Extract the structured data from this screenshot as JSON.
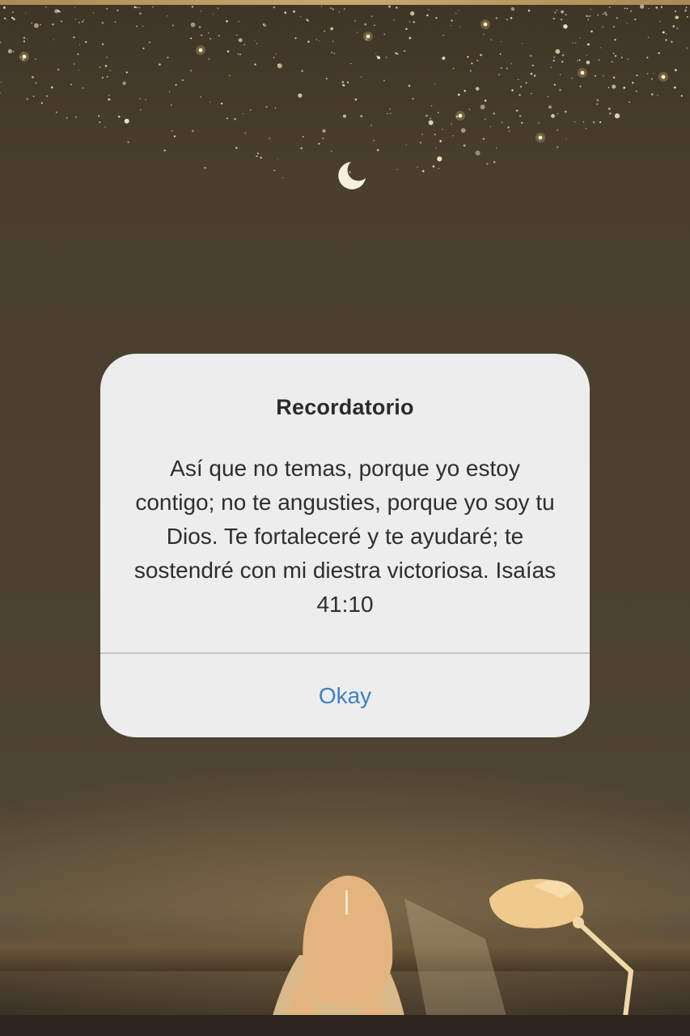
{
  "alert": {
    "title": "Recordatorio",
    "message": "Así que no temas, porque yo estoy contigo; no te angusties, porque yo soy tu Dios. Te fortaleceré y te ayudaré; te sostendré con mi diestra victoriosa. Isaías 41:10",
    "button_label": "Okay"
  },
  "colors": {
    "dialog_background": "#ededee",
    "button_text": "#3d82c4",
    "wallpaper_base": "#4a3f2e"
  },
  "wallpaper": {
    "icons": [
      "moon-icon",
      "stars"
    ]
  }
}
